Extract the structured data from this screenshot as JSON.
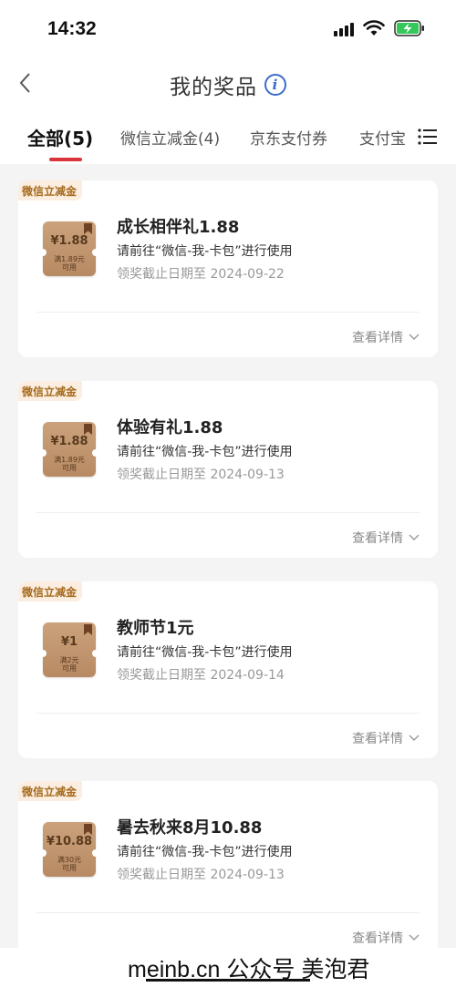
{
  "status_bar": {
    "time": "14:32"
  },
  "header": {
    "title": "我的奖品"
  },
  "tabs": [
    {
      "label": "全部(5)"
    },
    {
      "label": "微信立减金(4)"
    },
    {
      "label": "京东支付券"
    },
    {
      "label": "支付宝"
    }
  ],
  "colors": {
    "accent": "#d9343a",
    "badge_text": "#a66a1e",
    "coupon": "#c09570"
  },
  "cards": [
    {
      "badge": "微信立减金",
      "coupon_value": "¥1.88",
      "coupon_condition_1": "满1.89元",
      "coupon_condition_2": "可用",
      "title": "成长相伴礼1.88",
      "usage": "请前往“微信-我-卡包”进行使用",
      "deadline": "领奖截止日期至  2024-09-22",
      "detail_label": "查看详情"
    },
    {
      "badge": "微信立减金",
      "coupon_value": "¥1.88",
      "coupon_condition_1": "满1.89元",
      "coupon_condition_2": "可用",
      "title": "体验有礼1.88",
      "usage": "请前往“微信-我-卡包”进行使用",
      "deadline": "领奖截止日期至  2024-09-13",
      "detail_label": "查看详情"
    },
    {
      "badge": "微信立减金",
      "coupon_value": "¥1",
      "coupon_condition_1": "满2元",
      "coupon_condition_2": "可用",
      "title": "教师节1元",
      "usage": "请前往“微信-我-卡包”进行使用",
      "deadline": "领奖截止日期至  2024-09-14",
      "detail_label": "查看详情"
    },
    {
      "badge": "微信立减金",
      "coupon_value": "¥10.88",
      "coupon_condition_1": "满30元",
      "coupon_condition_2": "可用",
      "title": "暑去秋来8月10.88",
      "usage": "请前往“微信-我-卡包”进行使用",
      "deadline": "领奖截止日期至  2024-09-13",
      "detail_label": "查看详情"
    }
  ],
  "watermark": {
    "text": "meinb.cn  公众号 美泡君"
  }
}
